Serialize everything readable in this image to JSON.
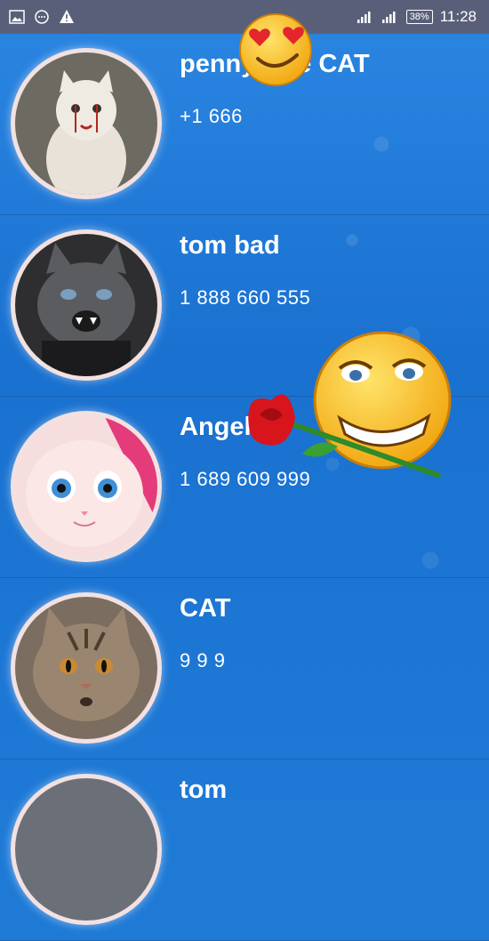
{
  "status_bar": {
    "battery": "38%",
    "time": "11:28"
  },
  "contacts": [
    {
      "name": "pennywise CAT",
      "phone": "+1 666"
    },
    {
      "name": "tom bad",
      "phone": "1 888 660 555"
    },
    {
      "name": "Angel",
      "phone": "1 689 609 999"
    },
    {
      "name": "CAT",
      "phone": "9 9 9"
    },
    {
      "name": "tom",
      "phone": ""
    }
  ],
  "colors": {
    "background": "#1f7ad6",
    "status_bar": "#5a5f79",
    "text": "#ffffff"
  }
}
